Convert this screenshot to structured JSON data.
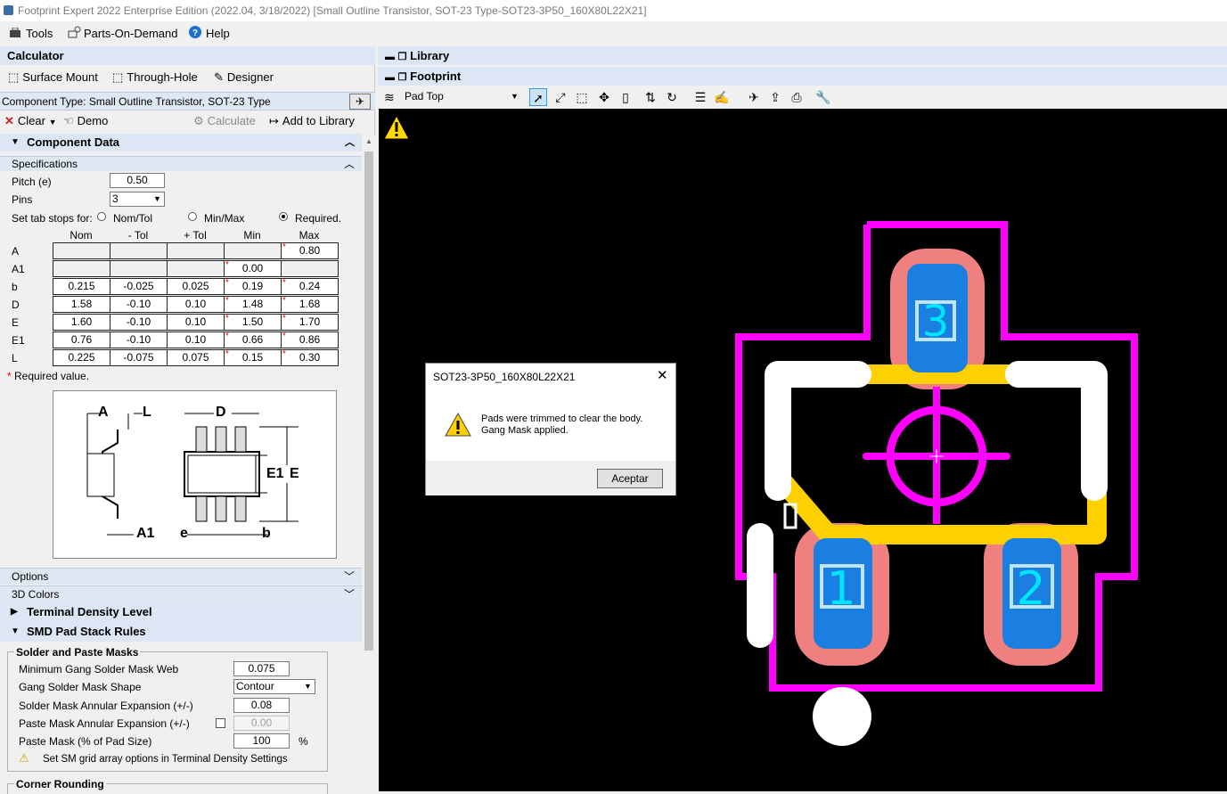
{
  "window": {
    "title": "Footprint Expert 2022 Enterprise Edition (2022.04, 3/18/2022) [Small Outline Transistor, SOT-23 Type-SOT23-3P50_160X80L22X21]"
  },
  "menu": {
    "tools": "Tools",
    "parts_on_demand": "Parts-On-Demand",
    "help": "Help"
  },
  "calculator": {
    "header": "Calculator",
    "tabs": {
      "surface_mount": "Surface Mount",
      "through_hole": "Through-Hole",
      "designer": "Designer"
    },
    "component_type": "Component Type: Small Outline Transistor, SOT-23 Type",
    "toolbar": {
      "clear": "Clear",
      "demo": "Demo",
      "calculate": "Calculate",
      "add_to_library": "Add to Library"
    },
    "component_data": "Component Data",
    "specifications": "Specifications",
    "pitch_label": "Pitch (e)",
    "pitch_value": "0.50",
    "pins_label": "Pins",
    "pins_value": "3",
    "tabstops_label": "Set tab stops for:",
    "tabstop_options": {
      "nomtol": "Nom/Tol",
      "minmax": "Min/Max",
      "required": "Required."
    },
    "columns": [
      "Nom",
      "- Tol",
      "+ Tol",
      "Min",
      "Max"
    ],
    "rows": [
      {
        "label": "A",
        "nom": "",
        "mtol": "",
        "ptol": "",
        "min": "",
        "max": "0.80"
      },
      {
        "label": "A1",
        "nom": "",
        "mtol": "",
        "ptol": "",
        "min": "0.00",
        "max": ""
      },
      {
        "label": "b",
        "nom": "0.215",
        "mtol": "-0.025",
        "ptol": "0.025",
        "min": "0.19",
        "max": "0.24"
      },
      {
        "label": "D",
        "nom": "1.58",
        "mtol": "-0.10",
        "ptol": "0.10",
        "min": "1.48",
        "max": "1.68"
      },
      {
        "label": "E",
        "nom": "1.60",
        "mtol": "-0.10",
        "ptol": "0.10",
        "min": "1.50",
        "max": "1.70"
      },
      {
        "label": "E1",
        "nom": "0.76",
        "mtol": "-0.10",
        "ptol": "0.10",
        "min": "0.66",
        "max": "0.86"
      },
      {
        "label": "L",
        "nom": "0.225",
        "mtol": "-0.075",
        "ptol": "0.075",
        "min": "0.15",
        "max": "0.30"
      }
    ],
    "required_note": "Required value.",
    "diagram_labels": {
      "A": "A",
      "L": "L",
      "D": "D",
      "E1": "E1",
      "E": "E",
      "A1": "A1",
      "e": "e",
      "b": "b"
    },
    "options": "Options",
    "colors_3d": "3D Colors",
    "terminal_density": "Terminal Density Level",
    "smd_rules": "SMD Pad Stack Rules",
    "masks_group": "Solder and Paste Masks",
    "min_gang_label": "Minimum Gang Solder Mask Web",
    "min_gang_value": "0.075",
    "gang_shape_label": "Gang Solder Mask Shape",
    "gang_shape_value": "Contour",
    "solder_exp_label": "Solder Mask Annular Expansion (+/-)",
    "solder_exp_value": "0.08",
    "paste_exp_label": "Paste Mask Annular Expansion (+/-)",
    "paste_exp_value": "0.00",
    "paste_size_label": "Paste Mask (% of Pad Size)",
    "paste_size_value": "100",
    "paste_size_unit": "%",
    "sm_grid_note": "Set SM grid array options in Terminal Density Settings",
    "corner_rounding": "Corner Rounding"
  },
  "library": {
    "header": "Library"
  },
  "footprint": {
    "header": "Footprint",
    "layer_value": "Pad Top",
    "pads": [
      {
        "number": "1"
      },
      {
        "number": "2"
      },
      {
        "number": "3"
      }
    ]
  },
  "dialog": {
    "title": "SOT23-3P50_160X80L22X21",
    "message_line1": "Pads were trimmed to clear the body.",
    "message_line2": "Gang Mask applied.",
    "ok": "Aceptar"
  },
  "colors": {
    "accent": "#dce6f4",
    "pad": "#1a7fe0",
    "mask": "#f08080",
    "courtyard": "#ff00ff",
    "silk": "#ffffff",
    "assembly": "#ffd000"
  }
}
